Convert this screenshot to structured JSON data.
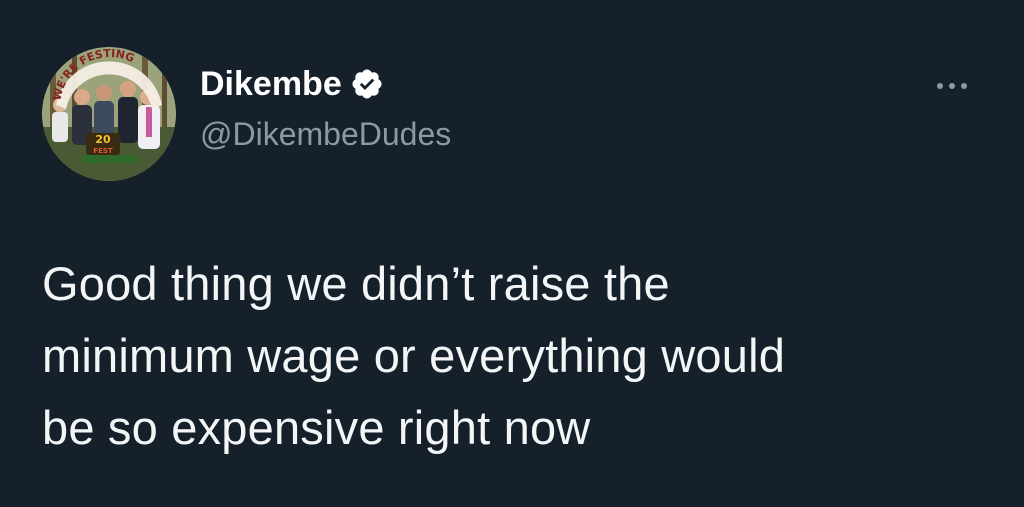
{
  "author": {
    "display_name": "Dikembe",
    "handle": "@DikembeDudes",
    "verified": true,
    "avatar_banner_text": "WE'RE FESTING",
    "avatar_badge_text": "20 FEST"
  },
  "tweet": {
    "lines": [
      "Good thing we didn’t raise the",
      "minimum wage or everything would",
      "be so expensive right now"
    ]
  },
  "icons": {
    "verified": "verified-badge-icon",
    "more": "more-options-icon"
  },
  "colors": {
    "background": "#15202b",
    "text": "#ffffff",
    "secondary_text": "#8b98a5"
  }
}
